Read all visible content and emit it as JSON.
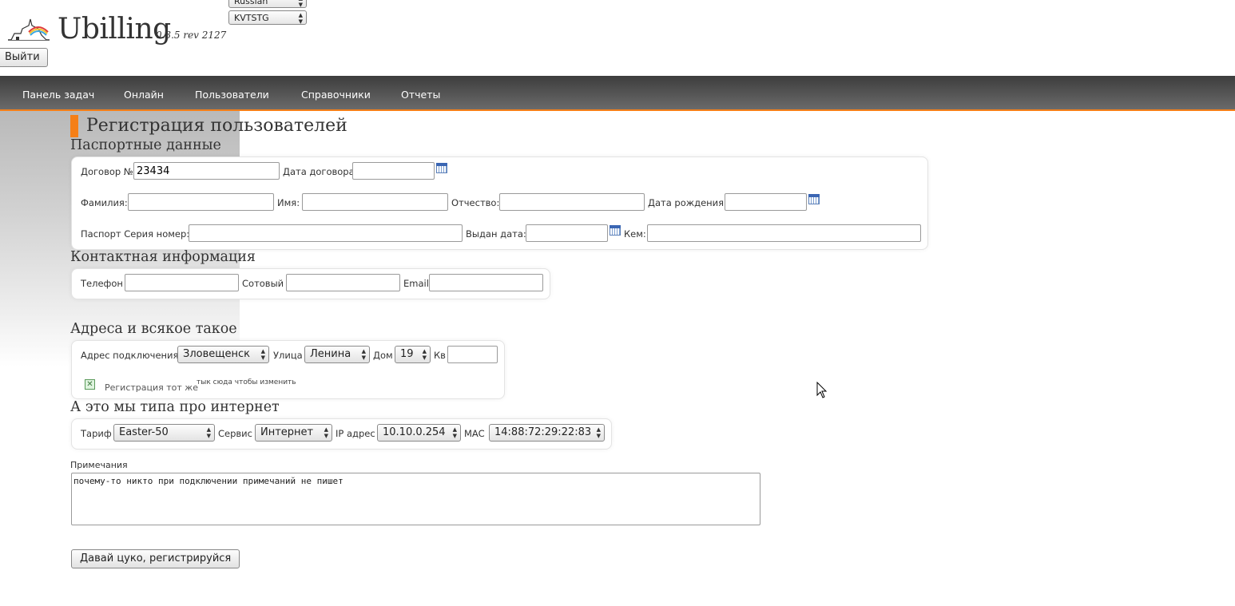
{
  "header": {
    "brand": "Ubilling",
    "version": "0.3.5 rev 2127",
    "language_select": "Russian",
    "skin_select": "KVTSTG",
    "logout_label": "Выйти"
  },
  "nav": {
    "items": [
      "Панель задач",
      "Онлайн",
      "Пользователи",
      "Справочники",
      "Отчеты"
    ]
  },
  "page": {
    "title": "Регистрация пользователей"
  },
  "passport": {
    "section_title": "Паспортные данные",
    "contract_label": "Договор №",
    "contract_value": "23434",
    "contract_date_label": "Дата договора",
    "surname_label": "Фамилия:",
    "name_label": "Имя:",
    "patronymic_label": "Отчество:",
    "birthdate_label": "Дата рождения:",
    "passport_label": "Паспорт Серия номер:",
    "issued_date_label": "Выдан дата:",
    "issued_by_label": "Кем:"
  },
  "contact": {
    "section_title": "Контактная информация",
    "phone_label": "Телефон",
    "mobile_label": "Сотовый",
    "email_label": "Email"
  },
  "address": {
    "section_title": "Адреса и всякое такое",
    "connect_label": "Адрес подключения:",
    "city_value": "Зловещенск",
    "street_label": "Улица",
    "street_value": "Ленина",
    "house_label": "Дом",
    "house_value": "19",
    "apt_label": "Кв",
    "same_reg_label": "Регистрация тот же",
    "change_hint": "тык сюда чтобы изменить"
  },
  "internet": {
    "section_title": "А это мы типа про интернет",
    "tariff_label": "Тариф",
    "tariff_value": "Easter-50",
    "service_label": "Сервис",
    "service_value": "Интернет",
    "ip_label": "IP адрес",
    "ip_value": "10.10.0.254",
    "mac_label": "MAC",
    "mac_value": "14:88:72:29:22:83"
  },
  "notes": {
    "label": "Примечания",
    "value": "почему-то никто при подключении примечаний не пишет"
  },
  "submit_label": "Давай цуко, регистрируйся",
  "colors": {
    "accent": "#f57f17",
    "nav_bg": "#4a4a4a"
  }
}
